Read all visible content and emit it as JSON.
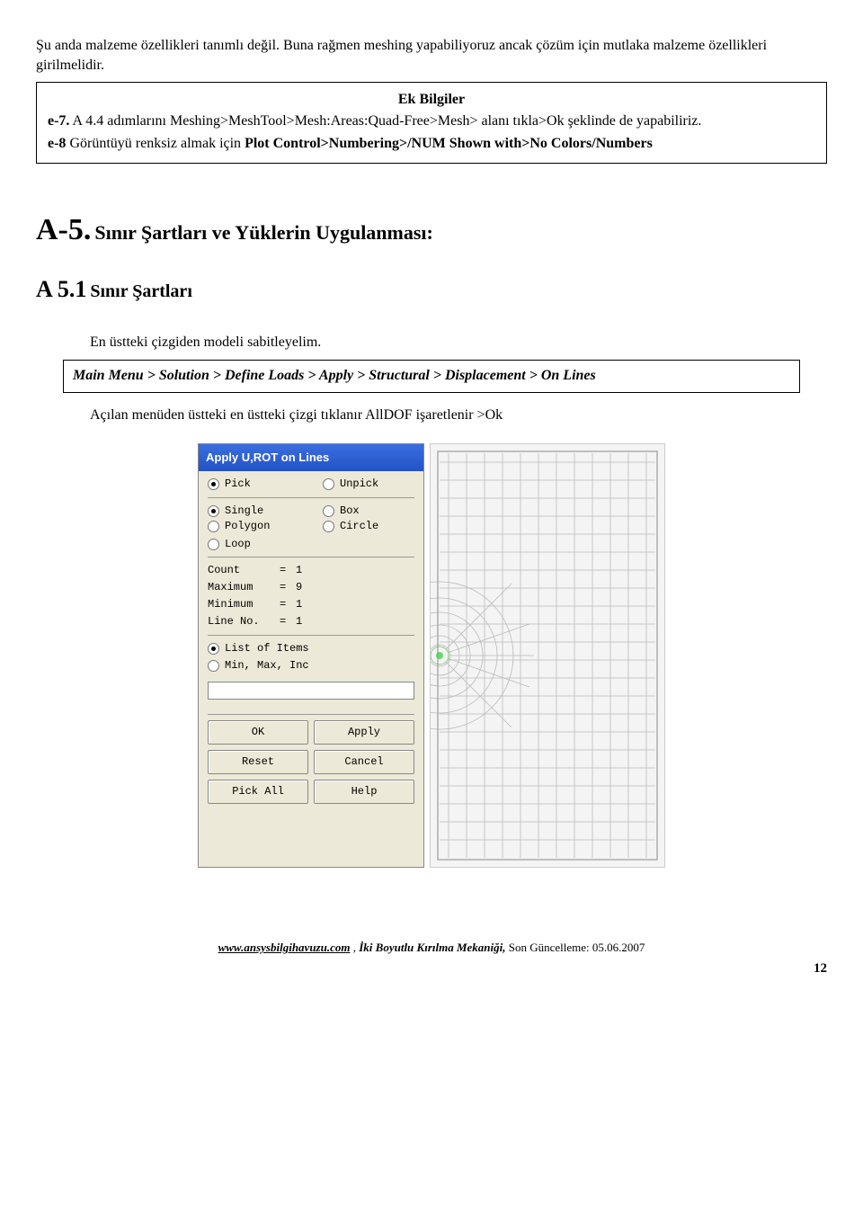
{
  "intro": {
    "p1": "Şu anda malzeme özellikleri tanımlı değil. Buna rağmen meshing yapabiliyoruz ancak çözüm için mutlaka malzeme özellikleri girilmelidir."
  },
  "infobox": {
    "title": "Ek Bilgiler",
    "line1a": "e-7.",
    "line1b": " A 4.4 adımlarını  Meshing>MeshTool>Mesh:Areas:Quad-Free>Mesh>  alanı tıkla>Ok  şeklinde de yapabiliriz.",
    "line2a": "e-8",
    "line2b": " Görüntüyü renksiz almak için ",
    "line2c": "Plot Control>Numbering>/NUM Shown with>No Colors/Numbers"
  },
  "sections": {
    "a5_num": "A-5.",
    "a5_title": "  Sınır Şartları ve Yüklerin Uygulanması:",
    "a51_num": "A 5.1",
    "a51_title": " Sınır Şartları",
    "a51_p1": "En üstteki çizgiden modeli sabitleyelim.",
    "cmd": "Main Menu > Solution > Define Loads > Apply > Structural >  Displacement > On Lines",
    "a51_p2": "Açılan menüden üstteki en üstteki çizgi tıklanır AllDOF işaretlenir  >Ok"
  },
  "dialog": {
    "title": "Apply U,ROT on Lines",
    "pick": "Pick",
    "unpick": "Unpick",
    "single": "Single",
    "box": "Box",
    "polygon": "Polygon",
    "circle": "Circle",
    "loop": "Loop",
    "count_l": "Count",
    "count_v": "1",
    "max_l": "Maximum",
    "max_v": "9",
    "min_l": "Minimum",
    "min_v": "1",
    "lineno_l": "Line No.",
    "lineno_v": "1",
    "list": "List of Items",
    "minmax": "Min, Max, Inc",
    "ok": "OK",
    "apply": "Apply",
    "reset": "Reset",
    "cancel": "Cancel",
    "pickall": "Pick All",
    "help": "Help"
  },
  "footer": {
    "site": "www.ansysbilgihavuzu.com",
    "sep": " ,   ",
    "doc": "İki Boyutlu Kırılma Mekaniği,",
    "date": "  Son Güncelleme: 05.06.2007",
    "page": "12"
  }
}
